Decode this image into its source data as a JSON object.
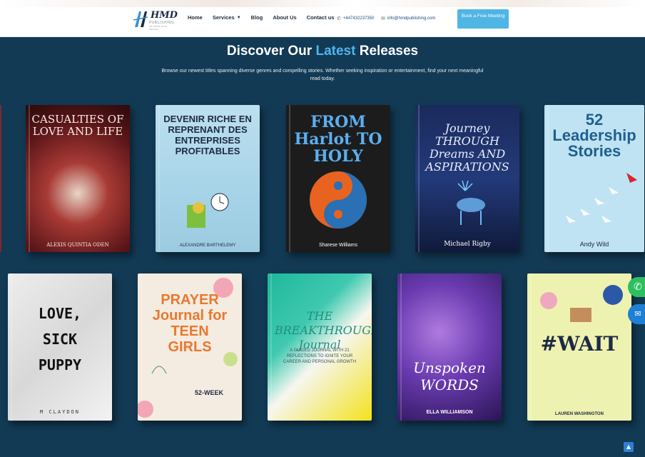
{
  "header": {
    "logo_text": "HMD",
    "logo_sub": "PUBLISHING",
    "logo_tagline": "WE WRITE YOUR DREAMS",
    "nav": [
      {
        "label": "Home"
      },
      {
        "label": "Services"
      },
      {
        "label": "Blog"
      },
      {
        "label": "About Us"
      },
      {
        "label": "Contact us"
      }
    ],
    "phone": "+447432237350",
    "email": "info@hmdpublishing.com",
    "cta": "Book a Free Meeting"
  },
  "hero": {
    "title_pre": "Discover Our",
    "title_accent": "Latest",
    "title_post": "Releases",
    "subtitle": "Browse our newest titles spanning diverse genres and compelling stories. Whether seeking inspiration or entertainment, find your next meaningful read today."
  },
  "books_row1": [
    {
      "title": "CASUALTIES OF LOVE AND LIFE",
      "author": "ALEXIS QUINTIA ODEN"
    },
    {
      "title": "DEVENIR RICHE EN REPRENANT DES ENTREPRISES PROFITABLES",
      "author": "ALEXANDRE BARTHELEMY"
    },
    {
      "title": "FROM Harlot TO HOLY",
      "author": "Sharese Williams"
    },
    {
      "title": "Journey THROUGH Dreams AND ASPIRATIONS",
      "author": "Michael Rigby"
    },
    {
      "title": "52 Leadership Stories",
      "author": "Andy Wild"
    }
  ],
  "books_row2": [
    {
      "title": "LOVE, SICK PUPPY",
      "author": "M CLAYDON"
    },
    {
      "title": "PRAYER Journal for TEEN GIRLS",
      "author": "52-WEEK"
    },
    {
      "title": "THE BREAKTHROUGH Journal",
      "author": "A GUIDED JOURNAL WITH 21 REFLECTIONS TO IGNITE YOUR CAREER AND PERSONAL GROWTH"
    },
    {
      "title": "Unspoken WORDS",
      "author": "ELLA WILLIAMSON"
    },
    {
      "title": "#WAIT",
      "author": "LAUREN WASHINGTON"
    }
  ],
  "colors": {
    "background": "#123a55",
    "accent": "#4fb5f0",
    "cta": "#4fb5e4"
  }
}
